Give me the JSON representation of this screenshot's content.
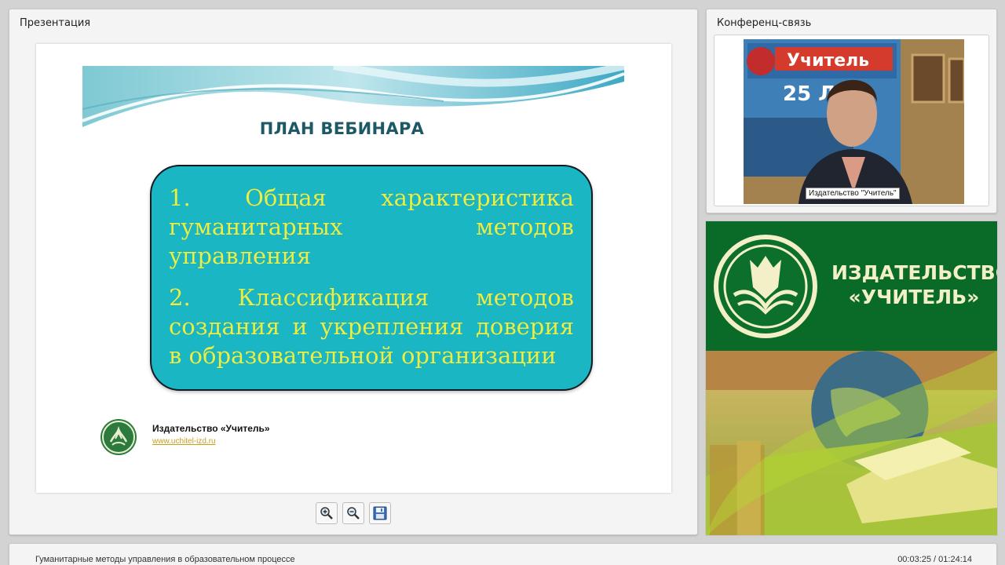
{
  "presentation": {
    "panel_title": "Презентация",
    "slide": {
      "heading": "ПЛАН ВЕБИНАРА",
      "items": [
        "1. Общая характеристика гуманитарных методов управления",
        "2. Классификация методов создания и укрепления доверия в образовательной организации"
      ],
      "footer_name": "Издательство «Учитель»",
      "footer_url": "www.uchitel-izd.ru"
    },
    "toolbar": {
      "zoom_in_icon": "zoom-in-icon",
      "zoom_out_icon": "zoom-out-icon",
      "save_icon": "floppy-disk-icon"
    }
  },
  "conference": {
    "panel_title": "Конференц-связь",
    "video_caption": "Издательство \"Учитель\""
  },
  "ad": {
    "line1": "ИЗДАТЕЛЬСТВО",
    "line2": "«УЧИТЕЛЬ»",
    "brand_green": "#0a6b28"
  },
  "status": {
    "title": "Гуманитарные методы управления в образовательном процессе",
    "time": "00:03:25 / 01:24:14"
  }
}
